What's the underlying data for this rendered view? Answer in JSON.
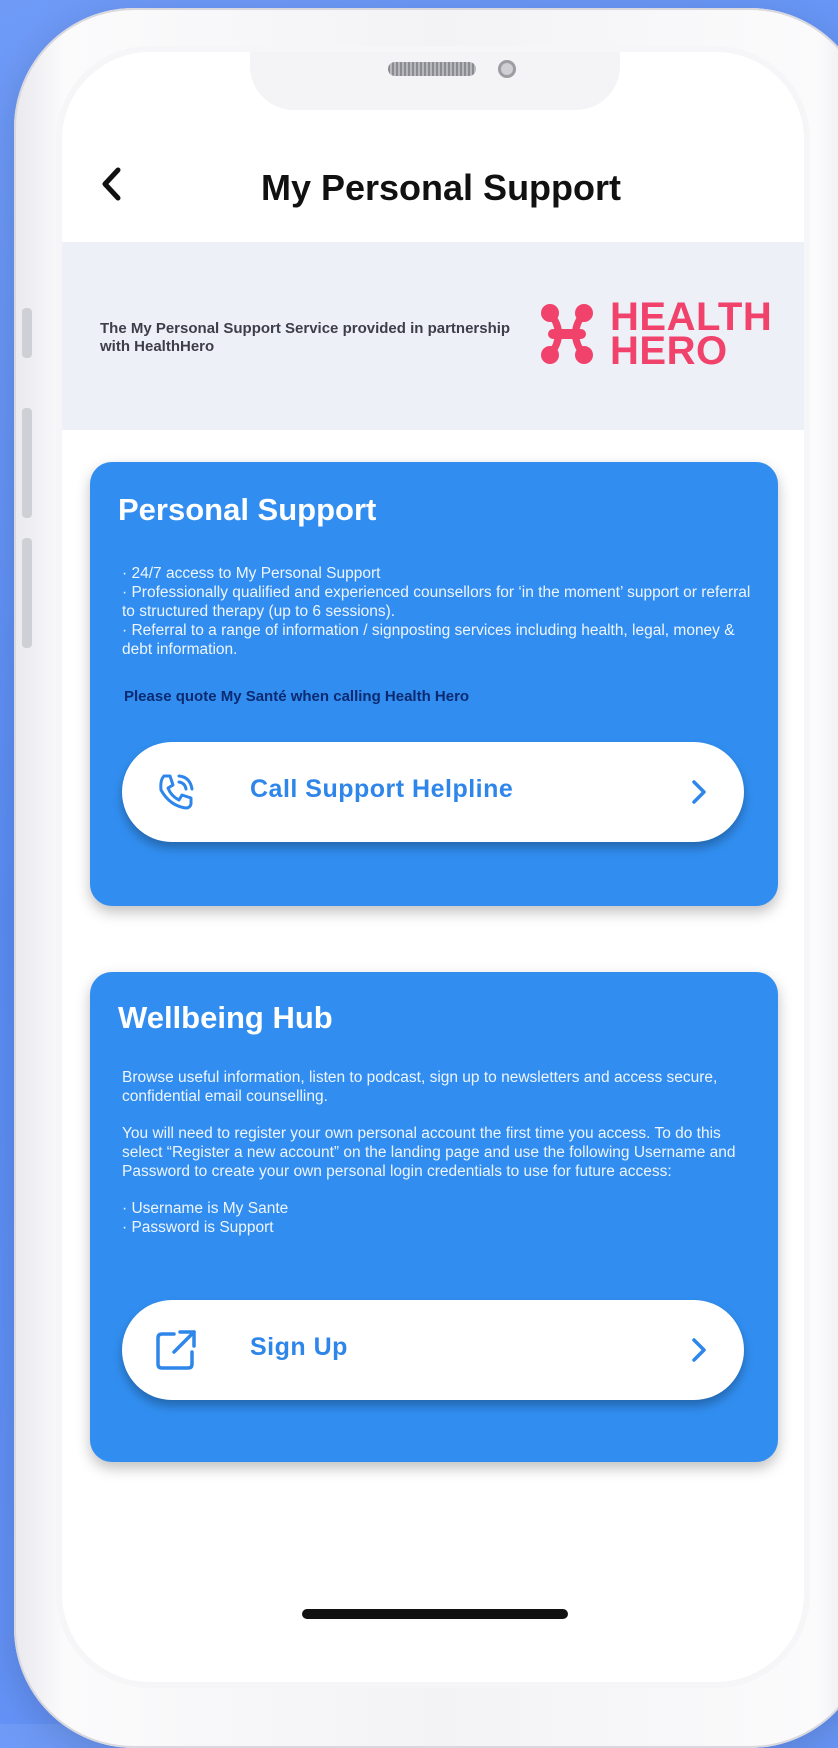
{
  "header": {
    "title": "My Personal Support",
    "back_icon": "chevron-left-icon"
  },
  "partner": {
    "description": "The My Personal Support Service provided in partnership with HealthHero",
    "logo_line1": "HEALTH",
    "logo_line2": "HERO",
    "logo_color": "#f0426b"
  },
  "personal_support": {
    "title": "Personal Support",
    "bullets": [
      "24/7 access to My Personal Support",
      "Professionally qualified and experienced counsellors for ‘in the moment’ support or referral to structured therapy (up to 6 sessions).",
      "Referral to a range of information / signposting services including health, legal, money & debt information."
    ],
    "note": "Please quote My Santé when calling Health Hero",
    "button_label": "Call Support Helpline",
    "button_icon": "phone-call-icon"
  },
  "wellbeing_hub": {
    "title": "Wellbeing Hub",
    "paragraph1": "Browse useful information, listen to podcast, sign up to newsletters and access secure, confidential email counselling.",
    "paragraph2": "You will need to register your own personal account the first time you access. To do this select “Register a new account” on the landing page and use the following Username and Password to create your own personal login credentials to use for future access:",
    "credentials": [
      "Username is My Sante",
      "Password is Support"
    ],
    "button_label": "Sign Up",
    "button_icon": "external-link-icon"
  },
  "colors": {
    "card_blue": "#318ef0",
    "accent_blue": "#2f86ea",
    "partner_bg": "#edf0f7"
  }
}
